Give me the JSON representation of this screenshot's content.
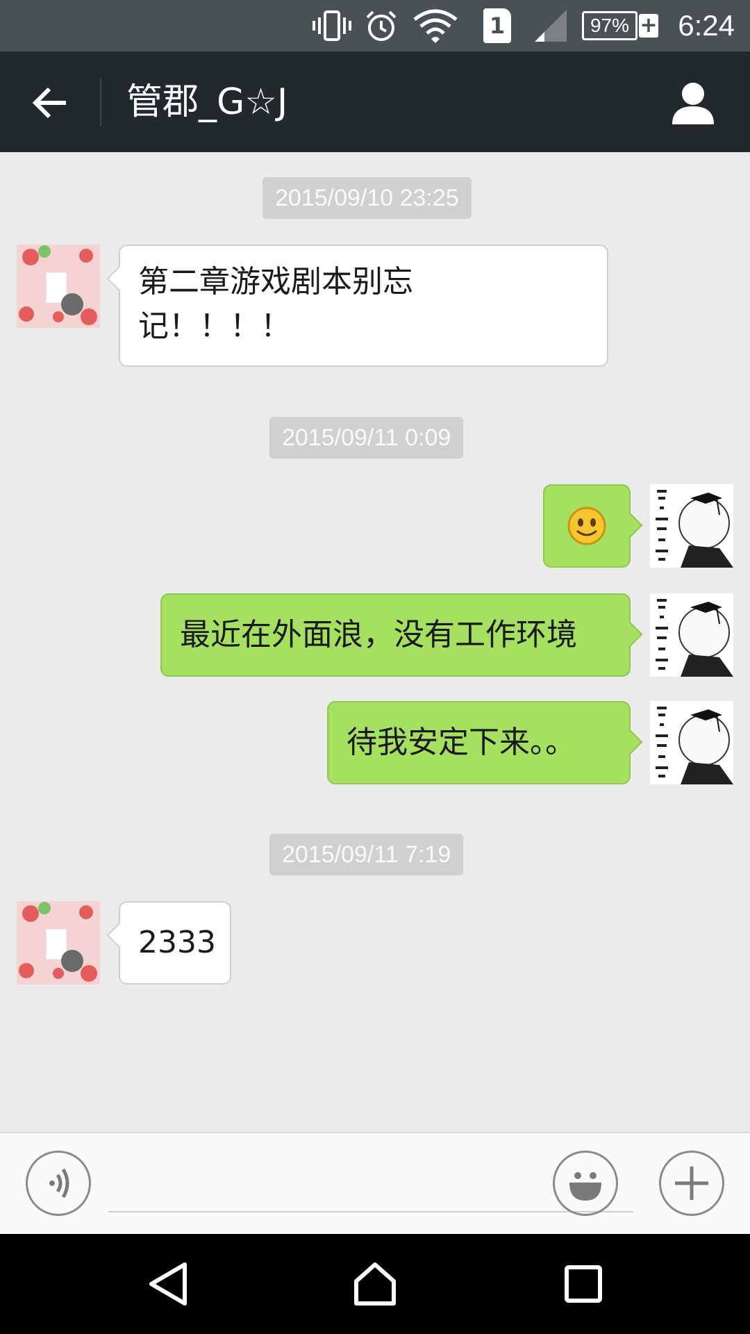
{
  "status_bar": {
    "icons": [
      "vibrate-icon",
      "alarm-icon",
      "wifi-icon",
      "sim-icon",
      "signal-icon",
      "battery-icon"
    ],
    "sim_slot": "1",
    "battery": "97%",
    "time": "6:24"
  },
  "header": {
    "title": "管郡_G☆J",
    "back_icon": "arrow-left-icon",
    "profile_icon": "person-icon"
  },
  "messages": [
    {
      "type": "timestamp",
      "text": "2015/09/10 23:25"
    },
    {
      "type": "received",
      "lines": [
        "第二章游戏剧本别忘",
        "记！！！！"
      ]
    },
    {
      "type": "timestamp",
      "text": "2015/09/11 0:09"
    },
    {
      "type": "sent",
      "emoji": "smile-emoji"
    },
    {
      "type": "sent",
      "text": "最近在外面浪，没有工作环境"
    },
    {
      "type": "sent",
      "text": "待我安定下来。。"
    },
    {
      "type": "timestamp",
      "text": "2015/09/11 7:19"
    },
    {
      "type": "received",
      "text": "2333"
    }
  ],
  "input_bar": {
    "voice_icon": "voice-icon",
    "input_value": "",
    "emoji_icon": "emoji-icon",
    "add_icon": "plus-icon"
  },
  "nav_bar": {
    "icons": [
      "back-triangle-icon",
      "home-icon",
      "recents-icon"
    ]
  },
  "colors": {
    "status_bar": "#4a5154",
    "title_bar": "#22292c",
    "chat_bg": "#ebebeb",
    "sent_bubble": "#a5e060",
    "received_bubble": "#ffffff",
    "timestamp_bg": "#d0d0d0"
  }
}
